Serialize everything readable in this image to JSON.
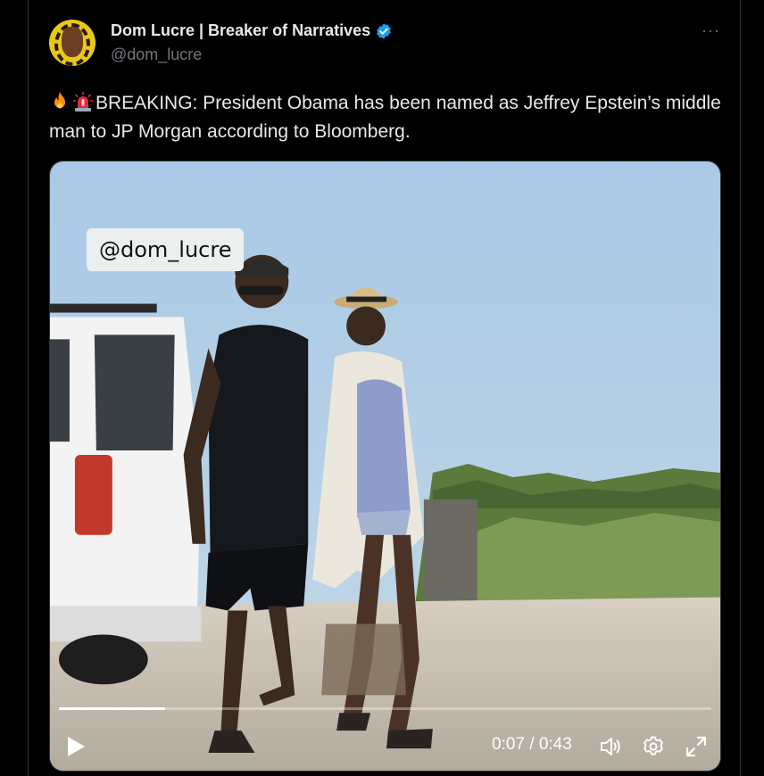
{
  "author": {
    "name": "Dom Lucre | Breaker of Narratives",
    "handle": "@dom_lucre",
    "verified": true
  },
  "icons": {
    "avatar": "avatar",
    "verified": "verified-badge-icon",
    "more": "more-options-icon",
    "fire": "fire-emoji",
    "siren": "siren-emoji",
    "play": "play-icon",
    "volume": "volume-icon",
    "settings": "settings-gear-icon",
    "fullscreen": "fullscreen-icon"
  },
  "more_label": "···",
  "tweet": {
    "text": "BREAKING: President Obama has been named as Jeffrey Epstein’s middle man to JP Morgan according to Bloomberg."
  },
  "video": {
    "watermark": "@dom_lucre",
    "time_display": "0:07 / 0:43",
    "progress_fraction": 0.163
  },
  "colors": {
    "background": "#000000",
    "verified_blue": "#1d9bf0",
    "secondary_text": "#71767b"
  }
}
